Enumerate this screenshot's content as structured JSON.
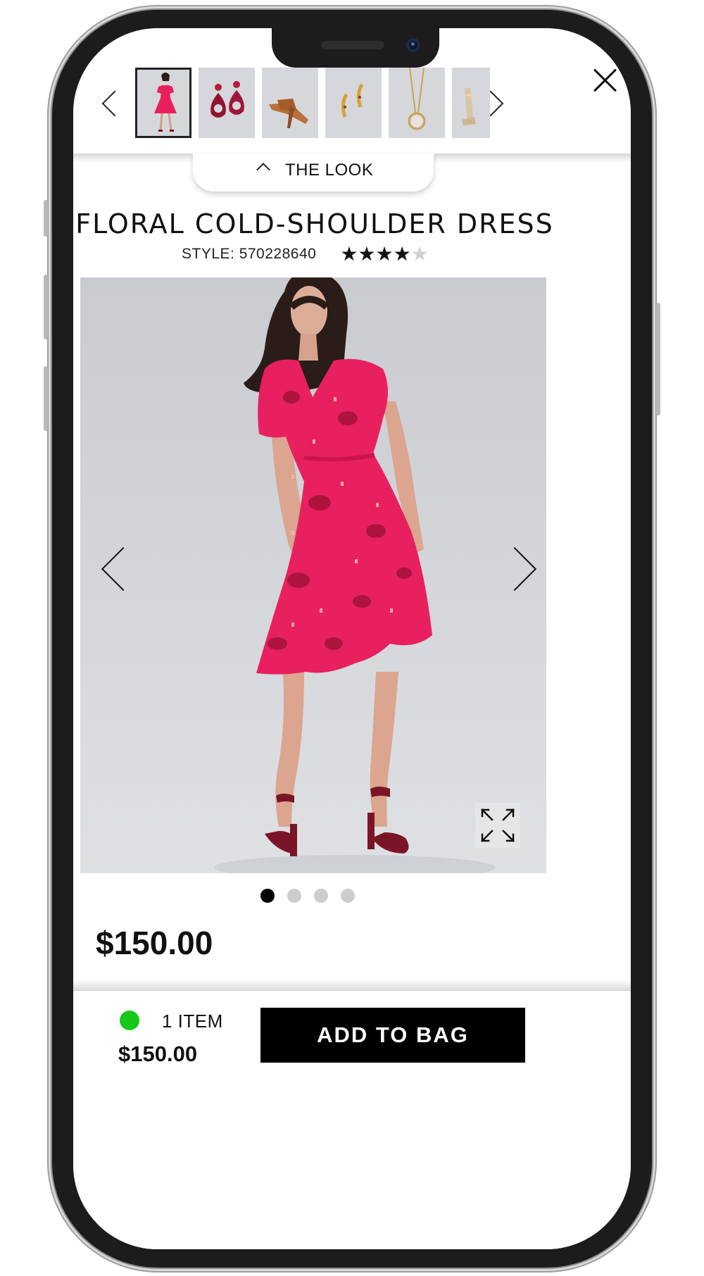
{
  "look": {
    "label": "THE LOOK",
    "thumbnails": [
      {
        "icon": "dress-thumbnail",
        "selected": true
      },
      {
        "icon": "earrings-thumbnail",
        "selected": false
      },
      {
        "icon": "sandal-thumbnail",
        "selected": false
      },
      {
        "icon": "hoop-earrings-thumbnail",
        "selected": false
      },
      {
        "icon": "necklace-thumbnail",
        "selected": false
      },
      {
        "icon": "heels-thumbnail",
        "selected": false
      }
    ]
  },
  "product": {
    "title": "FLORAL COLD-SHOULDER DRESS",
    "style": "STYLE: 570228640",
    "rating": 4,
    "rating_max": 5,
    "price": "$150.00",
    "image_count": 4,
    "current_image": 1,
    "star_glyph": "★"
  },
  "bag": {
    "count": "1 ITEM",
    "total": "$150.00",
    "status_color": "#16c81a",
    "button_label": "ADD TO BAG"
  },
  "colors": {
    "dress": "#e8205f",
    "background": "#d3d4d8",
    "button": "#000000"
  }
}
